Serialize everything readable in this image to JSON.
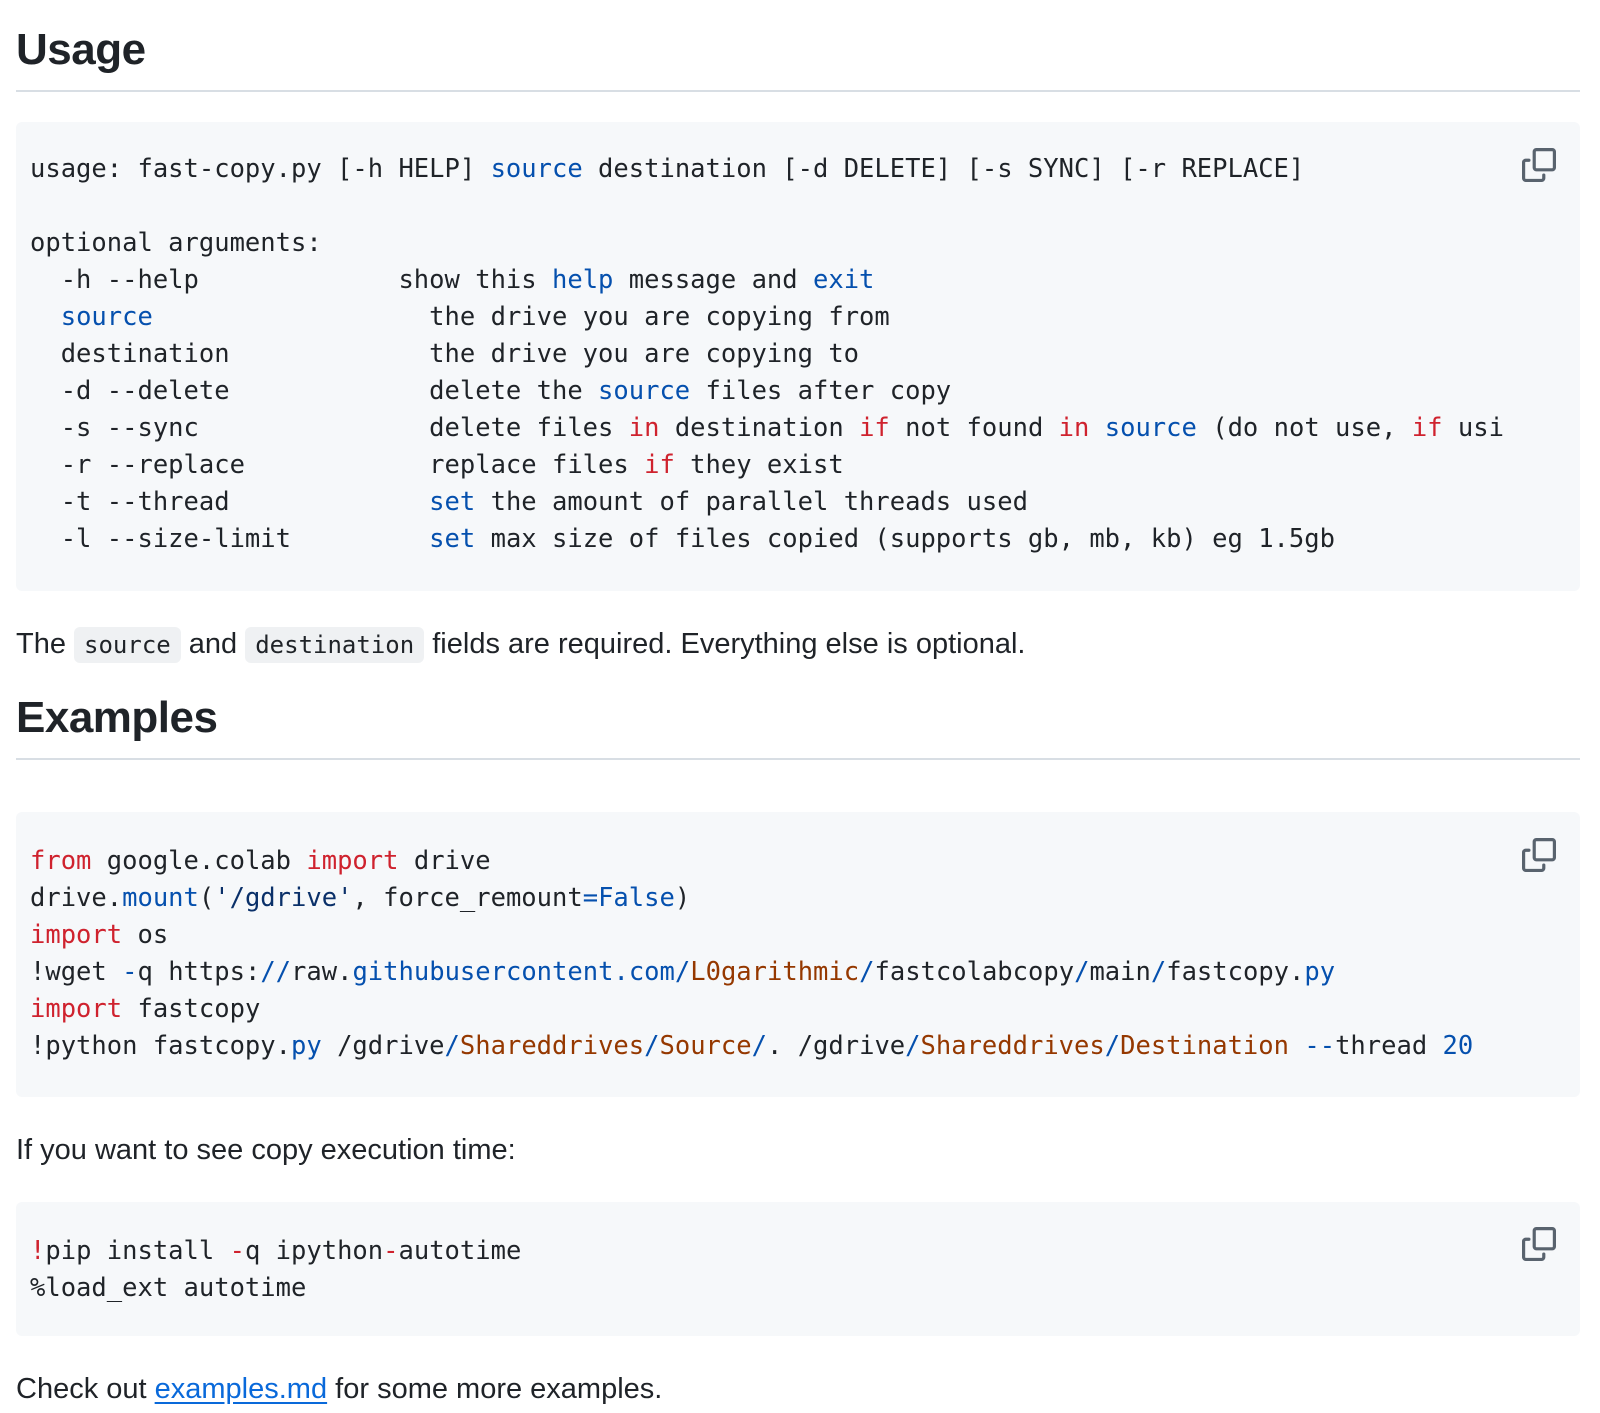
{
  "sections": {
    "usage_heading": "Usage",
    "examples_heading": "Examples"
  },
  "usage_block": {
    "l1_a": "usage: fast-copy.py [-h HELP] ",
    "l1_b": "source",
    "l1_c": " destination [-d DELETE] [-s SYNC] [-r REPLACE]",
    "l2": "optional arguments:",
    "l3_a": "  -h --help             show this ",
    "l3_b": "help",
    "l3_c": " message and ",
    "l3_d": "exit",
    "l4_a": "  ",
    "l4_b": "source",
    "l4_c": "                  the drive you are copying from",
    "l5": "  destination             the drive you are copying to",
    "l6_a": "  -d --delete             delete the ",
    "l6_b": "source",
    "l6_c": " files after copy",
    "l7_a": "  -s --sync               delete files ",
    "l7_b": "in",
    "l7_c": " destination ",
    "l7_d": "if",
    "l7_e": " not found ",
    "l7_f": "in",
    "l7_g": " ",
    "l7_h": "source",
    "l7_i": " (do not use, ",
    "l7_j": "if",
    "l7_k": " usi",
    "l8_a": "  -r --replace            replace files ",
    "l8_b": "if",
    "l8_c": " they exist",
    "l9_a": "  -t --thread             ",
    "l9_b": "set",
    "l9_c": " the amount of parallel threads used",
    "l10_a": "  -l --size-limit         ",
    "l10_b": "set",
    "l10_c": " max size of files copied (supports gb, mb, kb) eg 1.5gb"
  },
  "examples_block": {
    "l1_a": "from",
    "l1_b": " google.colab ",
    "l1_c": "import",
    "l1_d": " drive",
    "l2_a": "drive.",
    "l2_b": "mount",
    "l2_c": "(",
    "l2_d": "'/gdrive'",
    "l2_e": ", force_remount",
    "l2_f": "=",
    "l2_g": "False",
    "l2_h": ")",
    "l3_a": "import",
    "l3_b": " os",
    "l4_a": "!wget ",
    "l4_b": "-",
    "l4_c": "q https:",
    "l4_d": "//",
    "l4_e": "raw.",
    "l4_f": "githubusercontent",
    "l4_g": ".",
    "l4_h": "com",
    "l4_i": "/",
    "l4_j": "L0garithmic",
    "l4_k": "/",
    "l4_l": "fastcolabcopy",
    "l4_m": "/",
    "l4_n": "main",
    "l4_o": "/",
    "l4_p": "fastcopy.",
    "l4_q": "py",
    "l5_a": "import",
    "l5_b": " fastcopy",
    "l6_a": "!python fastcopy.",
    "l6_b": "py",
    "l6_c": " /gdrive",
    "l6_d": "/",
    "l6_e": "Shareddrives",
    "l6_f": "/",
    "l6_g": "Source",
    "l6_h": "/",
    "l6_i": ". /gdrive",
    "l6_j": "/",
    "l6_k": "Shareddrives",
    "l6_l": "/",
    "l6_m": "Destination",
    "l6_n": " --",
    "l6_o": "thread ",
    "l6_p": "20"
  },
  "autotime_block": {
    "l1_a": "!",
    "l1_b": "pip install ",
    "l1_c": "-",
    "l1_d": "q ipython",
    "l1_e": "-",
    "l1_f": "autotime",
    "l2": "%load_ext autotime"
  },
  "paragraphs": {
    "required_a": "The ",
    "required_code1": "source",
    "required_b": " and ",
    "required_code2": "destination",
    "required_c": " fields are required. Everything else is optional.",
    "exectime": "If you want to see copy execution time:",
    "checkout_a": "Check out ",
    "checkout_link": "examples.md",
    "checkout_b": " for some more examples."
  },
  "icons": {
    "copy": "copy-icon"
  },
  "colors": {
    "keyword": "#cf222e",
    "function": "#0550ae",
    "string": "#0a3069",
    "path": "#953800",
    "link": "#0969da",
    "code_bg": "#f6f8fa"
  }
}
